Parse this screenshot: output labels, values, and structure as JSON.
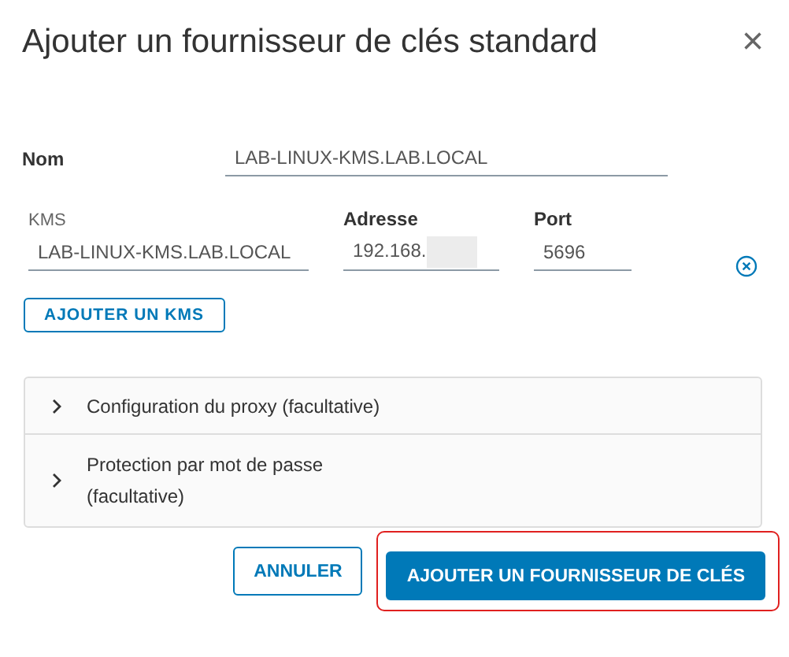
{
  "dialog": {
    "title": "Ajouter un fournisseur de clés standard",
    "close": "×"
  },
  "name_field": {
    "label": "Nom",
    "value": "LAB-LINUX-KMS.LAB.LOCAL"
  },
  "kms_columns": [
    "KMS",
    "Adresse",
    "Port"
  ],
  "kms_rows": [
    {
      "kms": "LAB-LINUX-KMS.LAB.LOCAL",
      "address": "192.168.",
      "address_redacted": true,
      "port": "5696"
    }
  ],
  "add_kms_button": "AJOUTER UN KMS",
  "sections": [
    {
      "label": "Configuration du proxy (facultative)",
      "expanded": false
    },
    {
      "label": "Protection par mot de passe (facultative)",
      "expanded": false
    }
  ],
  "buttons": [
    {
      "label": "ANNULER",
      "kind": "secondary",
      "highlighted": false
    },
    {
      "label": "AJOUTER UN FOURNISSEUR DE CLÉS",
      "kind": "primary",
      "highlighted": true
    }
  ]
}
